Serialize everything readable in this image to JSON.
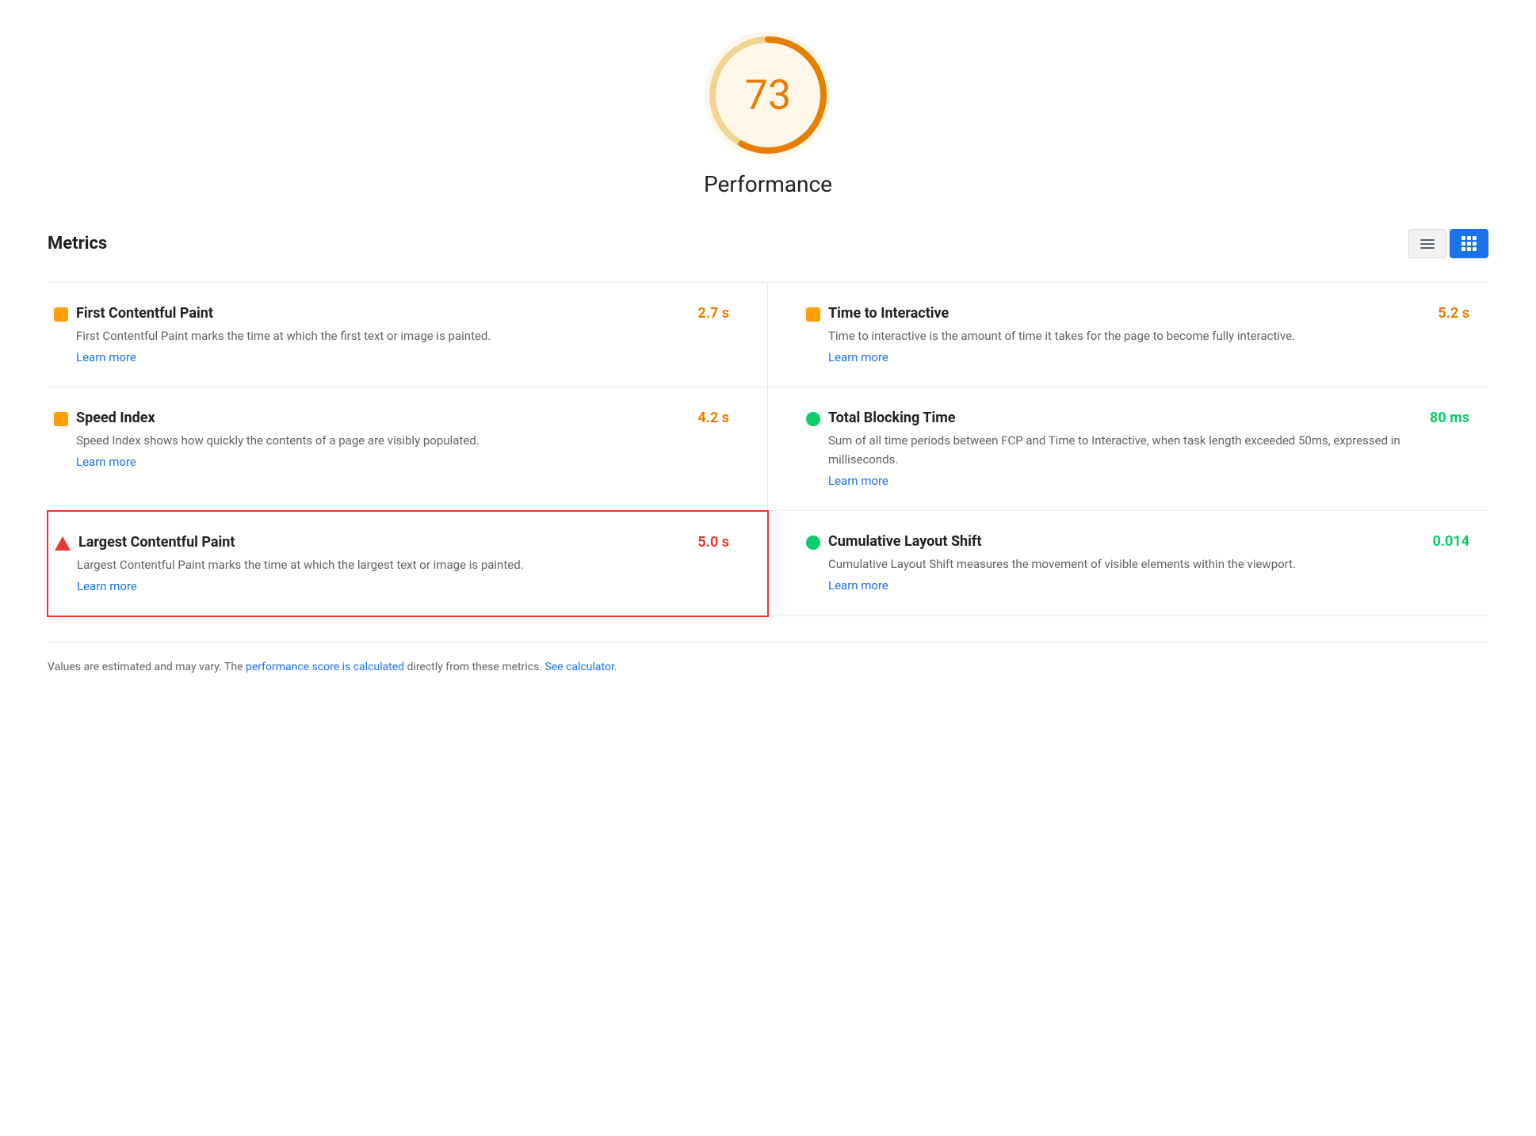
{
  "score": {
    "value": "73",
    "label": "Performance",
    "color": "#e67e00",
    "bg_color": "#fef7ea"
  },
  "metrics_section": {
    "title": "Metrics",
    "toggle_list_label": "List view",
    "toggle_grid_label": "Grid view"
  },
  "metrics": [
    {
      "id": "fcp",
      "name": "First Contentful Paint",
      "value": "2.7 s",
      "value_class": "orange",
      "icon_type": "square",
      "icon_color": "#ffa000",
      "description": "First Contentful Paint marks the time at which the first text or image is painted.",
      "link_text": "Learn more",
      "link_href": "#",
      "highlighted": false
    },
    {
      "id": "tti",
      "name": "Time to Interactive",
      "value": "5.2 s",
      "value_class": "orange",
      "icon_type": "square",
      "icon_color": "#ffa000",
      "description": "Time to interactive is the amount of time it takes for the page to become fully interactive.",
      "link_text": "Learn more",
      "link_href": "#",
      "highlighted": false
    },
    {
      "id": "si",
      "name": "Speed Index",
      "value": "4.2 s",
      "value_class": "orange",
      "icon_type": "square",
      "icon_color": "#ffa000",
      "description": "Speed Index shows how quickly the contents of a page are visibly populated.",
      "link_text": "Learn more",
      "link_href": "#",
      "highlighted": false
    },
    {
      "id": "tbt",
      "name": "Total Blocking Time",
      "value": "80 ms",
      "value_class": "green",
      "icon_type": "circle",
      "icon_color": "#0cce6b",
      "description": "Sum of all time periods between FCP and Time to Interactive, when task length exceeded 50ms, expressed in milliseconds.",
      "link_text": "Learn more",
      "link_href": "#",
      "highlighted": false
    },
    {
      "id": "lcp",
      "name": "Largest Contentful Paint",
      "value": "5.0 s",
      "value_class": "red",
      "icon_type": "triangle",
      "icon_color": "#e53935",
      "description": "Largest Contentful Paint marks the time at which the largest text or image is painted.",
      "link_text": "Learn more",
      "link_href": "#",
      "highlighted": true
    },
    {
      "id": "cls",
      "name": "Cumulative Layout Shift",
      "value": "0.014",
      "value_class": "green",
      "icon_type": "circle",
      "icon_color": "#0cce6b",
      "description": "Cumulative Layout Shift measures the movement of visible elements within the viewport.",
      "link_text": "Learn more",
      "link_href": "#",
      "highlighted": false
    }
  ],
  "footer": {
    "text_before": "Values are estimated and may vary. The ",
    "link1_text": "performance score is calculated",
    "link1_href": "#",
    "text_middle": " directly from these metrics. ",
    "link2_text": "See calculator.",
    "link2_href": "#"
  }
}
